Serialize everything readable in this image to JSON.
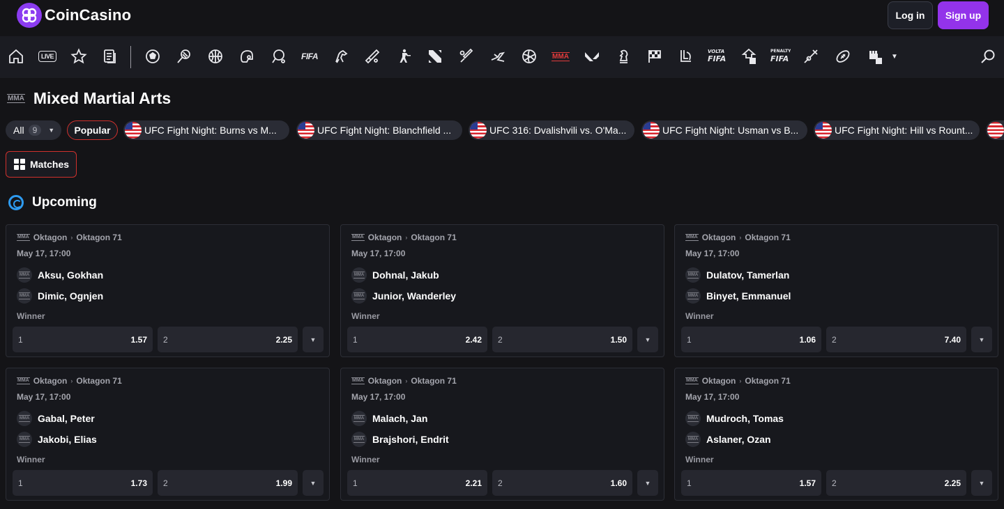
{
  "header": {
    "brand": "CoinCasino",
    "login_label": "Log in",
    "signup_label": "Sign up"
  },
  "sport_nav": {
    "live_label": "LIVE",
    "fifa_label": "FIFA",
    "mma_label": "MMA",
    "icons": [
      "home-icon",
      "live-icon",
      "star-icon",
      "betslip-icon",
      "soccer-icon",
      "tennis-icon",
      "basketball-icon",
      "hockey-icon",
      "table-tennis-icon",
      "fifa-icon",
      "horse-racing-icon",
      "cricket-icon",
      "counter-strike-icon",
      "dota-icon",
      "baseball-icon",
      "greyhound-icon",
      "volleyball-icon",
      "mma-icon",
      "valorant-icon",
      "chess-icon",
      "motorsport-icon",
      "league-of-legends-icon",
      "volta-fifa-icon",
      "nba2k-icon",
      "penalty-fifa-icon",
      "badminton-icon",
      "rugby-icon",
      "ebox-icon",
      "more-chevron-icon",
      "search-icon"
    ]
  },
  "page": {
    "sport_badge": "MMA",
    "title": "Mixed Martial Arts"
  },
  "filters": {
    "all_label": "All",
    "all_count": "9",
    "popular_label": "Popular",
    "events": [
      "UFC Fight Night: Burns vs M...",
      "UFC Fight Night: Blanchfield ...",
      "UFC 316: Dvalishvili vs. O'Ma...",
      "UFC Fight Night: Usman vs B...",
      "UFC Fight Night: Hill vs Rount..."
    ]
  },
  "tabs": {
    "matches_label": "Matches"
  },
  "section": {
    "title": "Upcoming"
  },
  "matches": [
    {
      "league": "Oktagon",
      "event": "Oktagon 71",
      "date": "May 17, 17:00",
      "home": "Aksu, Gokhan",
      "away": "Dimic, Ognjen",
      "market": "Winner",
      "o1_label": "1",
      "o1": "1.57",
      "o2_label": "2",
      "o2": "2.25"
    },
    {
      "league": "Oktagon",
      "event": "Oktagon 71",
      "date": "May 17, 17:00",
      "home": "Dohnal, Jakub",
      "away": "Junior, Wanderley",
      "market": "Winner",
      "o1_label": "1",
      "o1": "2.42",
      "o2_label": "2",
      "o2": "1.50"
    },
    {
      "league": "Oktagon",
      "event": "Oktagon 71",
      "date": "May 17, 17:00",
      "home": "Dulatov, Tamerlan",
      "away": "Binyet, Emmanuel",
      "market": "Winner",
      "o1_label": "1",
      "o1": "1.06",
      "o2_label": "2",
      "o2": "7.40"
    },
    {
      "league": "Oktagon",
      "event": "Oktagon 71",
      "date": "May 17, 17:00",
      "home": "Gabal, Peter",
      "away": "Jakobi, Elias",
      "market": "Winner",
      "o1_label": "1",
      "o1": "1.73",
      "o2_label": "2",
      "o2": "1.99"
    },
    {
      "league": "Oktagon",
      "event": "Oktagon 71",
      "date": "May 17, 17:00",
      "home": "Malach, Jan",
      "away": "Brajshori, Endrit",
      "market": "Winner",
      "o1_label": "1",
      "o1": "2.21",
      "o2_label": "2",
      "o2": "1.60"
    },
    {
      "league": "Oktagon",
      "event": "Oktagon 71",
      "date": "May 17, 17:00",
      "home": "Mudroch, Tomas",
      "away": "Aslaner, Ozan",
      "market": "Winner",
      "o1_label": "1",
      "o1": "1.57",
      "o2_label": "2",
      "o2": "2.25"
    }
  ],
  "colors": {
    "brand_purple": "#9333ea",
    "accent_red": "#d0312d",
    "upcoming_blue": "#2e9bf0",
    "background": "#141417"
  }
}
